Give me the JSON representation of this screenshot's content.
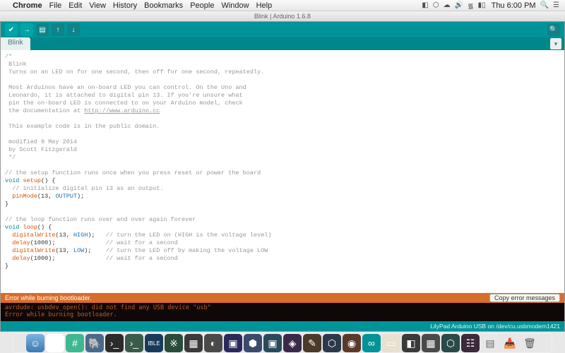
{
  "menubar": {
    "app": "Chrome",
    "items": [
      "File",
      "Edit",
      "View",
      "History",
      "Bookmarks",
      "People",
      "Window",
      "Help"
    ],
    "clock": "Thu 6:00 PM"
  },
  "window": {
    "title": "Blink | Arduino 1.6.8"
  },
  "tabs": {
    "active": "Blink"
  },
  "code": {
    "c1": "/*",
    "c2": " Blink",
    "c3": " Turns on an LED on for one second, then off for one second, repeatedly.",
    "c4": " Most Arduinos have an on-board LED you can control. On the Uno and",
    "c5": " Leonardo, it is attached to digital pin 13. If you're unsure what",
    "c6": " pin the on-board LED is connected to on your Arduino model, check",
    "c7": " the documentation at ",
    "c7link": "http://www.arduino.cc",
    "c8": " This example code is in the public domain.",
    "c9": " modified 8 May 2014",
    "c10": " by Scott Fitzgerald",
    "c11": " */",
    "l1": "// the setup function runs once when you press reset or power the board",
    "kw_void1": "void",
    "fn_setup": "setup",
    "par1": "() {",
    "l2": "  // initialize digital pin 13 as an output.",
    "fn_pinmode": "pinMode",
    "pm_args_a": "(13, ",
    "co_output": "OUTPUT",
    "pm_args_b": ");",
    "brace1": "}",
    "l3": "// the loop function runs over and over again forever",
    "kw_void2": "void",
    "fn_loop": "loop",
    "par2": "() {",
    "fn_dw1": "digitalWrite",
    "dw1a": "(13, ",
    "co_high": "HIGH",
    "dw1b": ");   ",
    "cm_dw1": "// turn the LED on (HIGH is the voltage level)",
    "fn_delay1": "delay",
    "d1": "(1000);              ",
    "cm_d1": "// wait for a second",
    "fn_dw2": "digitalWrite",
    "dw2a": "(13, ",
    "co_low": "LOW",
    "dw2b": ");    ",
    "cm_dw2": "// turn the LED off by making the voltage LOW",
    "fn_delay2": "delay",
    "d2": "(1000);              ",
    "cm_d2": "// wait for a second",
    "brace2": "}"
  },
  "error": {
    "header": "Error while burning bootloader.",
    "copy_label": "Copy error messages",
    "line1": "avrdude: usbdev_open(): did not find any USB device \"usb\"",
    "line2": "Error while burning bootloader."
  },
  "status": {
    "board": "LilyPad Arduino USB on /dev/cu.usbmodem1421"
  }
}
